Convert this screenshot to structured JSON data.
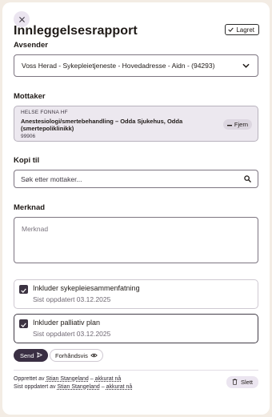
{
  "header": {
    "title": "Innleggelsesrapport",
    "saved_label": "Lagret"
  },
  "sender": {
    "label": "Avsender",
    "selected": "Voss Herad - Sykepleietjeneste - Hovedadresse - Aidn - (94293)"
  },
  "recipient": {
    "label": "Mottaker",
    "org": "HELSE FONNA HF",
    "name": "Anestesiologi/smertebehandling – Odda Sjukehus, Odda (smertepoliklinikk)",
    "code": "99906",
    "remove_label": "Fjern"
  },
  "copy_to": {
    "label": "Kopi til",
    "placeholder": "Søk etter mottaker..."
  },
  "note": {
    "label": "Merknad",
    "placeholder": "Merknad"
  },
  "options": [
    {
      "title": "Inkluder sykepleiesammenfatning",
      "subtitle": "Sist oppdatert 03.12.2025",
      "checked": true
    },
    {
      "title": "Inkluder palliativ plan",
      "subtitle": "Sist oppdatert 03.12.2025",
      "checked": true
    }
  ],
  "actions": {
    "send_label": "Send",
    "preview_label": "Forhåndsvis",
    "delete_label": "Slett"
  },
  "footer": {
    "created_prefix": "Opprettet av",
    "created_by": "Stian Stangeland",
    "created_sep": "–",
    "created_when": "akkurat nå",
    "updated_prefix": "Sist oppdatert av",
    "updated_by": "Stian Stangeland",
    "updated_sep": "–",
    "updated_when": "akkurat nå"
  },
  "colors": {
    "primary": "#3a2f43",
    "page_bg": "#f3ece4",
    "card_bg": "#ece8ef"
  }
}
